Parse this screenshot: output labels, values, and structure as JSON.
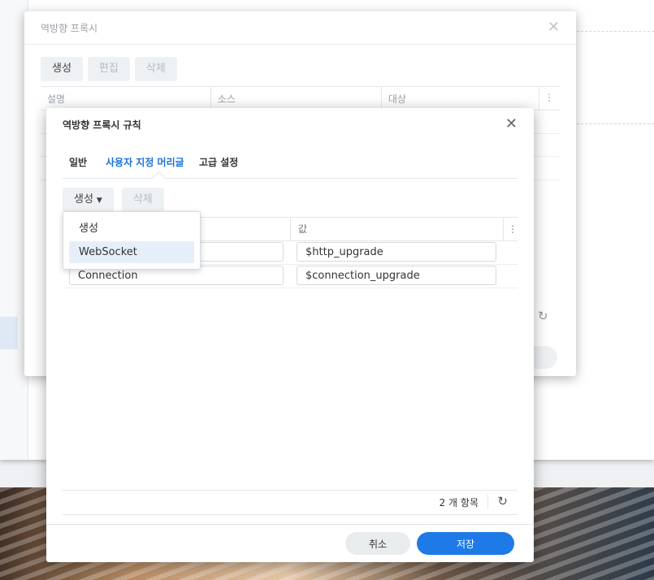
{
  "background_dialog": {
    "title": "역방향 프록시",
    "close_glyph": "✕",
    "toolbar": {
      "create": "생성",
      "edit": "편집",
      "delete": "삭제"
    },
    "columns": [
      "설명",
      "소스",
      "대상"
    ],
    "more_glyph": "⋮",
    "refresh_glyph": "↻"
  },
  "rule_dialog": {
    "title": "역방향 프록시 규칙",
    "close_glyph": "✕",
    "tabs": [
      {
        "label": "일반",
        "active": false
      },
      {
        "label": "사용자 지정 머리글",
        "active": true
      },
      {
        "label": "고급 설정",
        "active": false
      }
    ],
    "toolbar": {
      "create": "생성",
      "create_caret": "▼",
      "delete": "삭제"
    },
    "grid": {
      "columns": [
        "",
        "값"
      ],
      "more_glyph": "⋮",
      "rows": [
        {
          "name": "",
          "value": "$http_upgrade"
        },
        {
          "name": "Connection",
          "value": "$connection_upgrade"
        }
      ]
    },
    "dropdown": {
      "items": [
        {
          "label": "생성",
          "selected": false
        },
        {
          "label": "WebSocket",
          "selected": true
        }
      ]
    },
    "footer": {
      "count": "2 개 항목",
      "refresh_glyph": "↻"
    },
    "buttons": {
      "cancel": "취소",
      "save": "저장"
    },
    "accent_color": "#1d7ae6"
  }
}
